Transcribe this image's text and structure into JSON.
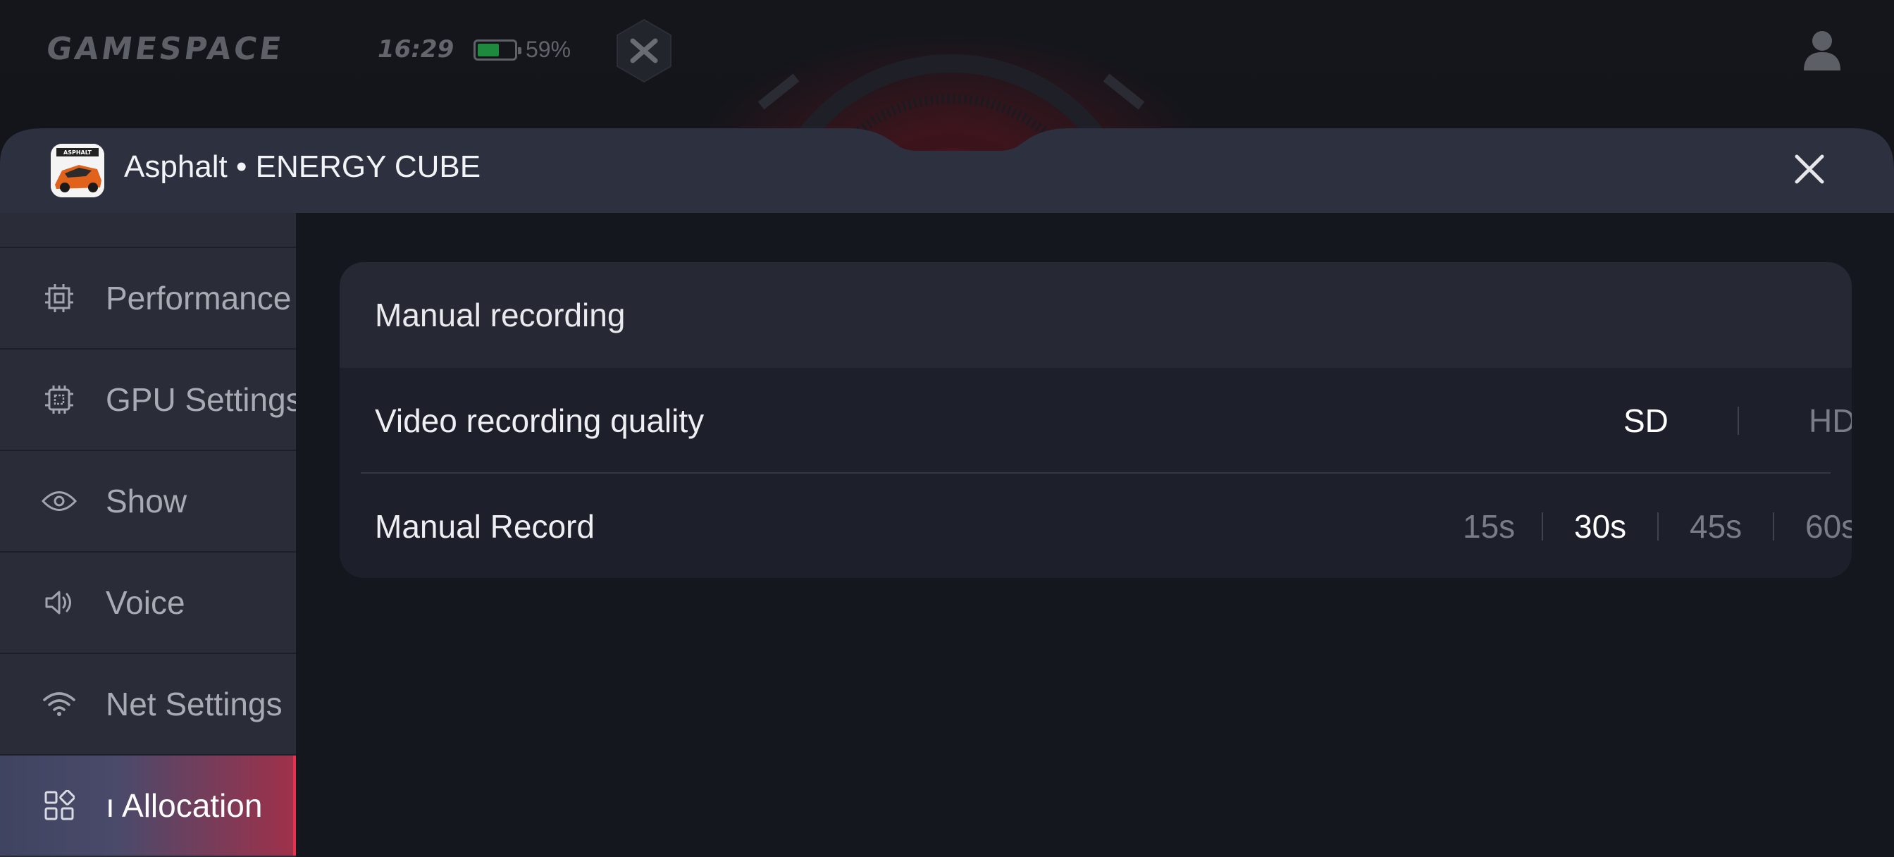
{
  "status_bar": {
    "logo_text": "GAMESPACE",
    "time": "16:29",
    "battery_level": 0.59,
    "battery_percent": "59%"
  },
  "panel": {
    "app_name": "Asphalt",
    "separator": "•",
    "mode_name": "ENERGY CUBE",
    "title": "Asphalt • ENERGY CUBE",
    "app_icon_text": "ASPHALT"
  },
  "sidebar": {
    "items": [
      {
        "label": "Performance",
        "icon": "cpu-chip-icon"
      },
      {
        "label": "GPU Settings",
        "icon": "gpu-chip-icon"
      },
      {
        "label": "Show",
        "icon": "eye-icon"
      },
      {
        "label": "Voice",
        "icon": "speaker-icon"
      },
      {
        "label": "Net Settings",
        "icon": "wifi-icon"
      },
      {
        "label": "ı Allocation",
        "icon": "grid-apps-icon",
        "active": true
      }
    ]
  },
  "content": {
    "card_title": "Manual recording",
    "quality": {
      "label": "Video recording quality",
      "options": [
        "SD",
        "HD"
      ],
      "selected": "SD"
    },
    "record": {
      "label": "Manual Record",
      "options": [
        "15s",
        "30s",
        "45s",
        "60s"
      ],
      "selected": "30s"
    }
  },
  "colors": {
    "accent": "#e8314c",
    "sidebar_bg": "#2a2c38",
    "content_bg": "#15171f",
    "card_bg": "#1d1f2a"
  }
}
